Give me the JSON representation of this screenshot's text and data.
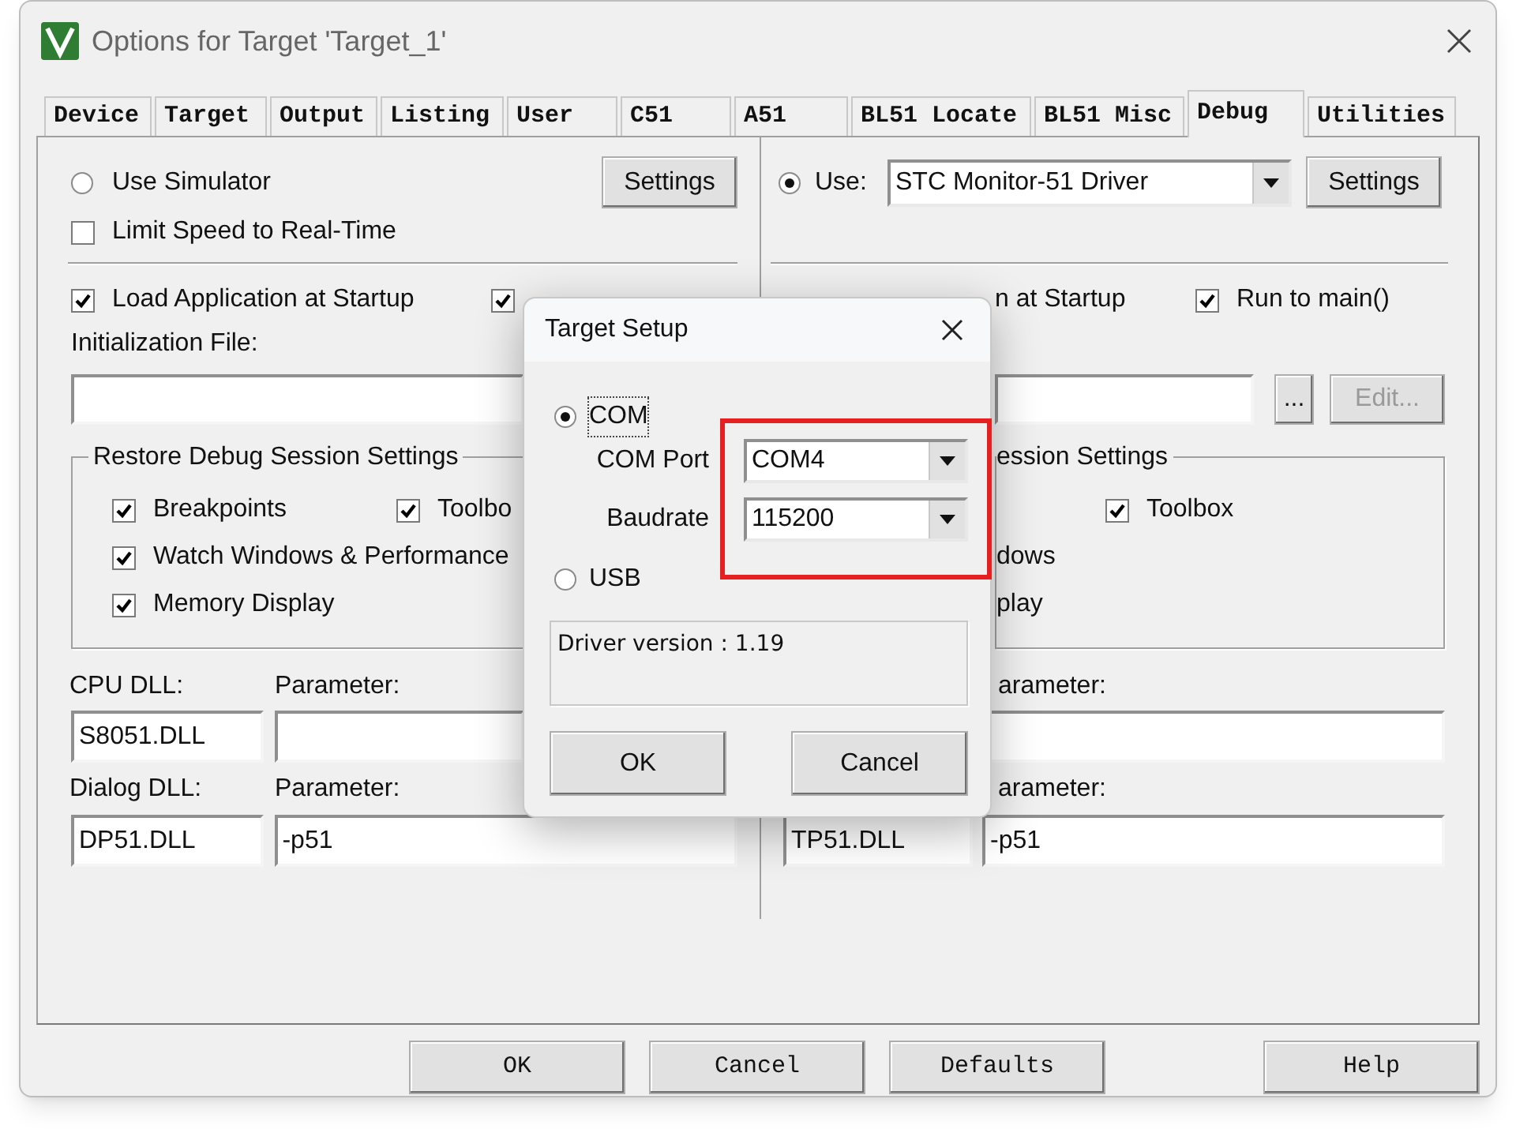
{
  "window": {
    "title": "Options for Target 'Target_1'"
  },
  "tabs": [
    {
      "label": "Device",
      "selected": false
    },
    {
      "label": "Target",
      "selected": false
    },
    {
      "label": "Output",
      "selected": false
    },
    {
      "label": "Listing",
      "selected": false
    },
    {
      "label": "User",
      "selected": false
    },
    {
      "label": "C51",
      "selected": false
    },
    {
      "label": "A51",
      "selected": false
    },
    {
      "label": "BL51 Locate",
      "selected": false
    },
    {
      "label": "BL51 Misc",
      "selected": false
    },
    {
      "label": "Debug",
      "selected": true
    },
    {
      "label": "Utilities",
      "selected": false
    }
  ],
  "left_panel": {
    "simulator_radio": {
      "label": "Use Simulator",
      "selected": false
    },
    "settings_button": "Settings",
    "limit_speed": {
      "label": "Limit Speed to Real-Time",
      "checked": false
    },
    "load_application": {
      "label": "Load Application at Startup",
      "checked": true
    },
    "checkbox_2": {
      "checked": true
    },
    "init_file_label": "Initialization File:",
    "restore_group": {
      "title": "Restore Debug Session Settings",
      "rows": [
        [
          {
            "kind": "checkbox",
            "label": "Breakpoints",
            "checked": true
          },
          {
            "kind": "checkbox",
            "label": "Toolbo",
            "checked": true
          }
        ],
        [
          {
            "kind": "checkbox",
            "label": "Watch Windows & Performance",
            "checked": true
          }
        ],
        [
          {
            "kind": "checkbox",
            "label": "Memory Display",
            "checked": true
          }
        ]
      ]
    },
    "cpu_dll": {
      "label": "CPU DLL:",
      "value": "S8051.DLL"
    },
    "cpu_parameter": {
      "label": "Parameter:"
    },
    "dialog_dll": {
      "label": "Dialog DLL:",
      "value": "DP51.DLL"
    },
    "dialog_parameter": {
      "label": "Parameter:",
      "value": "-p51"
    }
  },
  "right_panel": {
    "use_radio": {
      "label": "Use:",
      "selected": true
    },
    "driver": {
      "value": "STC Monitor-51 Driver"
    },
    "settings_button": "Settings",
    "load_application": {
      "label": "n at Startup"
    },
    "run_to_main": {
      "label": "Run to main()",
      "checked": true
    },
    "browse_button": "...",
    "edit_button": {
      "label": "Edit...",
      "disabled": true
    },
    "restore_group": {
      "title": "ession Settings",
      "rows": [
        [
          {
            "kind": "checkbox",
            "label": "Toolbox",
            "checked": true
          }
        ],
        [
          {
            "kind": "text",
            "label": "dows"
          }
        ],
        [
          {
            "kind": "text",
            "label": "play"
          }
        ]
      ]
    },
    "cpu_parameter": {
      "label": "arameter:"
    },
    "dialog_dll": {
      "value": "TP51.DLL"
    },
    "dialog_parameter": {
      "label": "arameter:",
      "value": "-p51"
    }
  },
  "target_setup": {
    "title": "Target Setup",
    "options": [
      {
        "label": "COM",
        "selected": true
      },
      {
        "label": "USB",
        "selected": false
      }
    ],
    "com_port": {
      "label": "COM Port",
      "value": "COM4"
    },
    "baudrate": {
      "label": "Baudrate",
      "value": "115200"
    },
    "highlighted": true,
    "driver_version": "Driver version : 1.19",
    "buttons": [
      "OK",
      "Cancel"
    ]
  },
  "buttons": [
    "OK",
    "Cancel",
    "Defaults",
    "Help"
  ]
}
